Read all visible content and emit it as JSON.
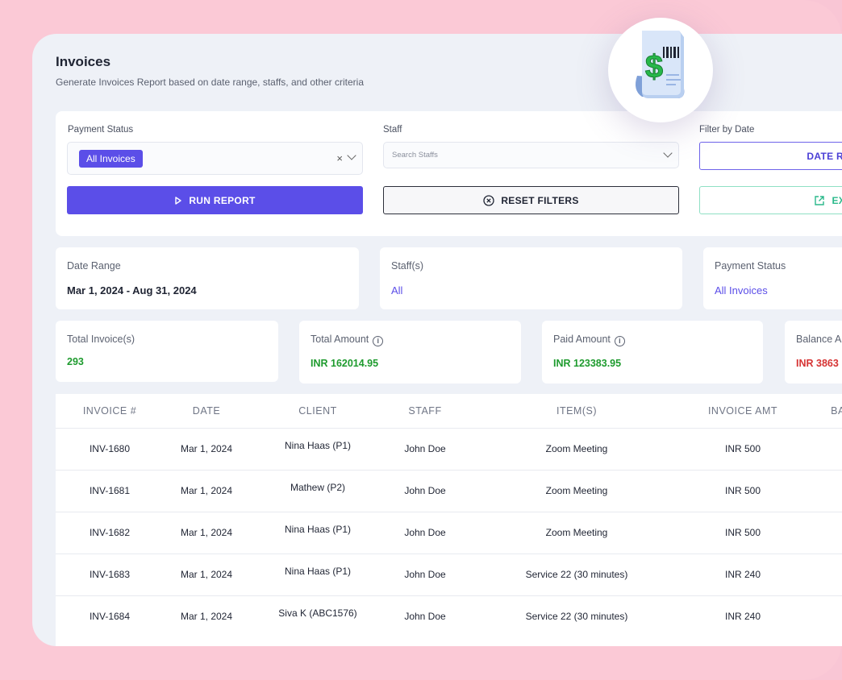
{
  "page": {
    "title": "Invoices",
    "subtitle": "Generate Invoices Report based on date range, staffs, and other criteria"
  },
  "filters": {
    "payment_status_label": "Payment Status",
    "payment_status_value": "All Invoices",
    "clear_glyph": "×",
    "staff_label": "Staff",
    "staff_placeholder": "Search Staffs",
    "date_label": "Filter by Date",
    "date_button": "DATE R",
    "run_button": "RUN REPORT",
    "reset_button": "RESET FILTERS",
    "export_button": "EXPO"
  },
  "summary": {
    "date_range_label": "Date Range",
    "date_range_value": "Mar 1, 2024 - Aug 31, 2024",
    "staff_label": "Staff(s)",
    "staff_value": "All",
    "status_label": "Payment Status",
    "status_value": "All Invoices"
  },
  "stats": {
    "total_invoices_label": "Total Invoice(s)",
    "total_invoices_value": "293",
    "total_amount_label": "Total Amount",
    "total_amount_value": "INR 162014.95",
    "paid_amount_label": "Paid Amount",
    "paid_amount_value": "INR 123383.95",
    "balance_label": "Balance A",
    "balance_value": "INR 3863",
    "info_glyph": "i"
  },
  "colors": {
    "accent": "#5b4ee8",
    "positive": "#1e9b2e",
    "negative": "#d63333",
    "export": "#2bb98b",
    "receipt_green": "#27b84a"
  },
  "receipt_dollar": "$",
  "table": {
    "headers": [
      "INVOICE #",
      "DATE",
      "CLIENT",
      "STAFF",
      "ITEM(S)",
      "INVOICE AMT",
      "BA"
    ],
    "rows": [
      [
        "INV-1680",
        "Mar 1, 2024",
        "Nina Haas (P1)",
        "John Doe",
        "Zoom Meeting",
        "INR 500"
      ],
      [
        "INV-1681",
        "Mar 1, 2024",
        "Mathew (P2)",
        "John Doe",
        "Zoom Meeting",
        "INR 500"
      ],
      [
        "INV-1682",
        "Mar 1, 2024",
        "Nina Haas (P1)",
        "John Doe",
        "Zoom Meeting",
        "INR 500"
      ],
      [
        "INV-1683",
        "Mar 1, 2024",
        "Nina Haas (P1)",
        "John Doe",
        "Service 22 (30 minutes)",
        "INR 240"
      ],
      [
        "INV-1684",
        "Mar 1, 2024",
        "Siva K (ABC1576)",
        "John Doe",
        "Service 22 (30 minutes)",
        "INR 240"
      ]
    ]
  }
}
